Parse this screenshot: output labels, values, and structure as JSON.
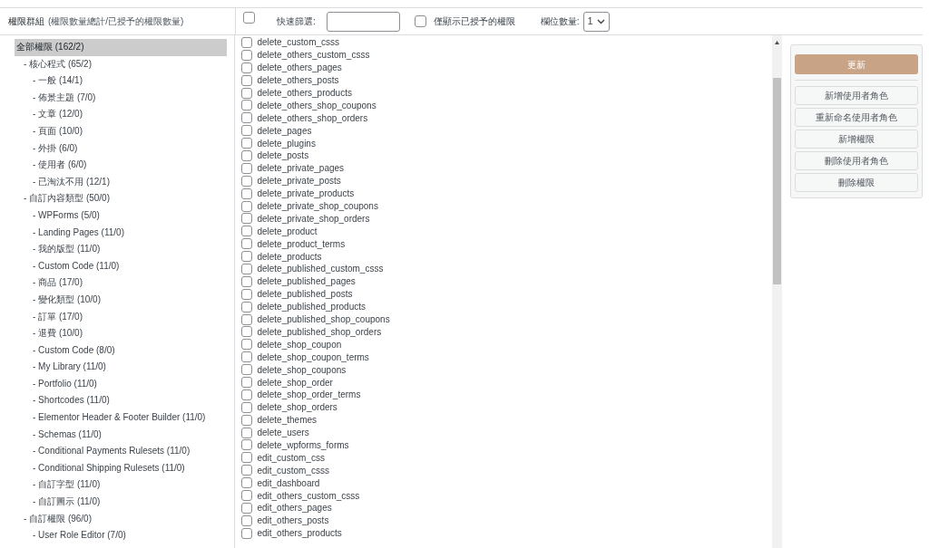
{
  "header": {
    "group_label": "權限群組",
    "group_hint": "(權限數量總計/已授予的權限數量)",
    "select_all": {
      "checked": false
    },
    "quick_filter_label": "快速篩選:",
    "granted_only": {
      "label": "僅顯示已授予的權限",
      "checked": false
    },
    "columns_label": "欄位數量:",
    "columns_value": "1"
  },
  "tree": [
    {
      "label": "全部權限 (162/2)",
      "selected": true,
      "children": [
        {
          "label": "- 核心程式 (65/2)",
          "selected": false,
          "children": [
            {
              "label": "- 一般 (14/1)",
              "selected": false
            },
            {
              "label": "- 佈景主題 (7/0)",
              "selected": false
            },
            {
              "label": "- 文章 (12/0)",
              "selected": false
            },
            {
              "label": "- 頁面 (10/0)",
              "selected": false
            },
            {
              "label": "- 外掛 (6/0)",
              "selected": false
            },
            {
              "label": "- 使用者 (6/0)",
              "selected": false
            },
            {
              "label": "- 已淘汰不用 (12/1)",
              "selected": false
            }
          ]
        },
        {
          "label": "- 自訂內容類型 (50/0)",
          "selected": false,
          "children": [
            {
              "label": "- WPForms (5/0)",
              "selected": false
            },
            {
              "label": "- Landing Pages (11/0)",
              "selected": false
            },
            {
              "label": "- 我的版型 (11/0)",
              "selected": false
            },
            {
              "label": "- Custom Code (11/0)",
              "selected": false
            },
            {
              "label": "- 商品 (17/0)",
              "selected": false
            },
            {
              "label": "- 變化類型 (10/0)",
              "selected": false
            },
            {
              "label": "- 訂單 (17/0)",
              "selected": false
            },
            {
              "label": "- 退費 (10/0)",
              "selected": false
            },
            {
              "label": "- Custom Code (8/0)",
              "selected": false
            },
            {
              "label": "- My Library (11/0)",
              "selected": false
            },
            {
              "label": "- Portfolio (11/0)",
              "selected": false
            },
            {
              "label": "- Shortcodes (11/0)",
              "selected": false
            },
            {
              "label": "- Elementor Header & Footer Builder (11/0)",
              "selected": false
            },
            {
              "label": "- Schemas (11/0)",
              "selected": false
            },
            {
              "label": "- Conditional Payments Rulesets (11/0)",
              "selected": false
            },
            {
              "label": "- Conditional Shipping Rulesets (11/0)",
              "selected": false
            },
            {
              "label": "- 自訂字型 (11/0)",
              "selected": false
            },
            {
              "label": "- 自訂圖示 (11/0)",
              "selected": false
            }
          ]
        },
        {
          "label": "- 自訂權限 (96/0)",
          "selected": false,
          "children": [
            {
              "label": "- User Role Editor (7/0)",
              "selected": false
            }
          ]
        }
      ]
    }
  ],
  "capabilities": [
    {
      "name": "delete_custom_csss",
      "checked": false
    },
    {
      "name": "delete_others_custom_csss",
      "checked": false
    },
    {
      "name": "delete_others_pages",
      "checked": false
    },
    {
      "name": "delete_others_posts",
      "checked": false
    },
    {
      "name": "delete_others_products",
      "checked": false
    },
    {
      "name": "delete_others_shop_coupons",
      "checked": false
    },
    {
      "name": "delete_others_shop_orders",
      "checked": false
    },
    {
      "name": "delete_pages",
      "checked": false
    },
    {
      "name": "delete_plugins",
      "checked": false
    },
    {
      "name": "delete_posts",
      "checked": false
    },
    {
      "name": "delete_private_pages",
      "checked": false
    },
    {
      "name": "delete_private_posts",
      "checked": false
    },
    {
      "name": "delete_private_products",
      "checked": false
    },
    {
      "name": "delete_private_shop_coupons",
      "checked": false
    },
    {
      "name": "delete_private_shop_orders",
      "checked": false
    },
    {
      "name": "delete_product",
      "checked": false
    },
    {
      "name": "delete_product_terms",
      "checked": false
    },
    {
      "name": "delete_products",
      "checked": false
    },
    {
      "name": "delete_published_custom_csss",
      "checked": false
    },
    {
      "name": "delete_published_pages",
      "checked": false
    },
    {
      "name": "delete_published_posts",
      "checked": false
    },
    {
      "name": "delete_published_products",
      "checked": false
    },
    {
      "name": "delete_published_shop_coupons",
      "checked": false
    },
    {
      "name": "delete_published_shop_orders",
      "checked": false
    },
    {
      "name": "delete_shop_coupon",
      "checked": false
    },
    {
      "name": "delete_shop_coupon_terms",
      "checked": false
    },
    {
      "name": "delete_shop_coupons",
      "checked": false
    },
    {
      "name": "delete_shop_order",
      "checked": false
    },
    {
      "name": "delete_shop_order_terms",
      "checked": false
    },
    {
      "name": "delete_shop_orders",
      "checked": false
    },
    {
      "name": "delete_themes",
      "checked": false
    },
    {
      "name": "delete_users",
      "checked": false
    },
    {
      "name": "delete_wpforms_forms",
      "checked": false
    },
    {
      "name": "edit_custom_css",
      "checked": false
    },
    {
      "name": "edit_custom_csss",
      "checked": false
    },
    {
      "name": "edit_dashboard",
      "checked": false
    },
    {
      "name": "edit_others_custom_csss",
      "checked": false
    },
    {
      "name": "edit_others_pages",
      "checked": false
    },
    {
      "name": "edit_others_posts",
      "checked": false
    },
    {
      "name": "edit_others_products",
      "checked": false
    }
  ],
  "actions": {
    "primary": "更新",
    "buttons": [
      "新增使用者角色",
      "重新命名使用者角色",
      "新增權限",
      "刪除使用者角色",
      "刪除權限"
    ]
  }
}
